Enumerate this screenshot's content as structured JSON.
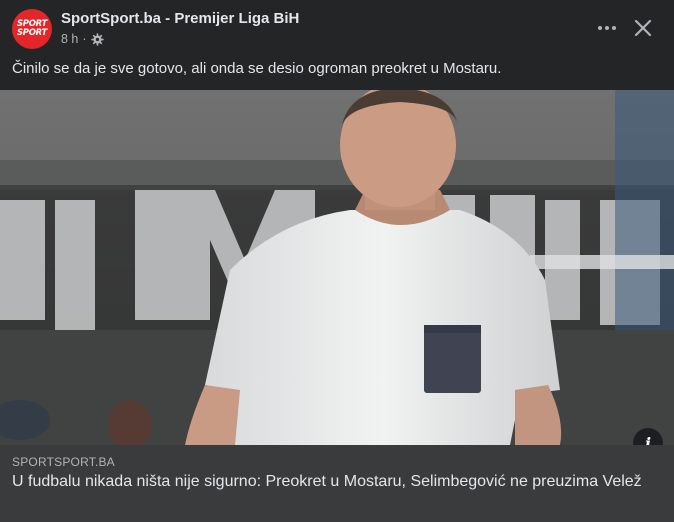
{
  "post": {
    "page_name": "SportSport.ba - Premijer Liga BiH",
    "avatar_text_line1": "SPORT",
    "avatar_text_line2": "SPORT",
    "time": "8 h",
    "separator": "·",
    "privacy_icon": "gear-icon",
    "caption": "Činilo se da je sve gotovo, ali onda se desio ogroman preokret u Mostaru."
  },
  "link": {
    "domain": "SPORTSPORT.BA",
    "headline": "U fudbalu nikada ništa nije sigurno: Preokret u Mostaru, Selimbegović ne preuzima Velež",
    "info_icon": "i"
  },
  "colors": {
    "background": "#242526",
    "footer": "#3a3b3c",
    "text_primary": "#e4e6eb",
    "text_secondary": "#b0b3b8",
    "brand_red": "#e4252a"
  }
}
